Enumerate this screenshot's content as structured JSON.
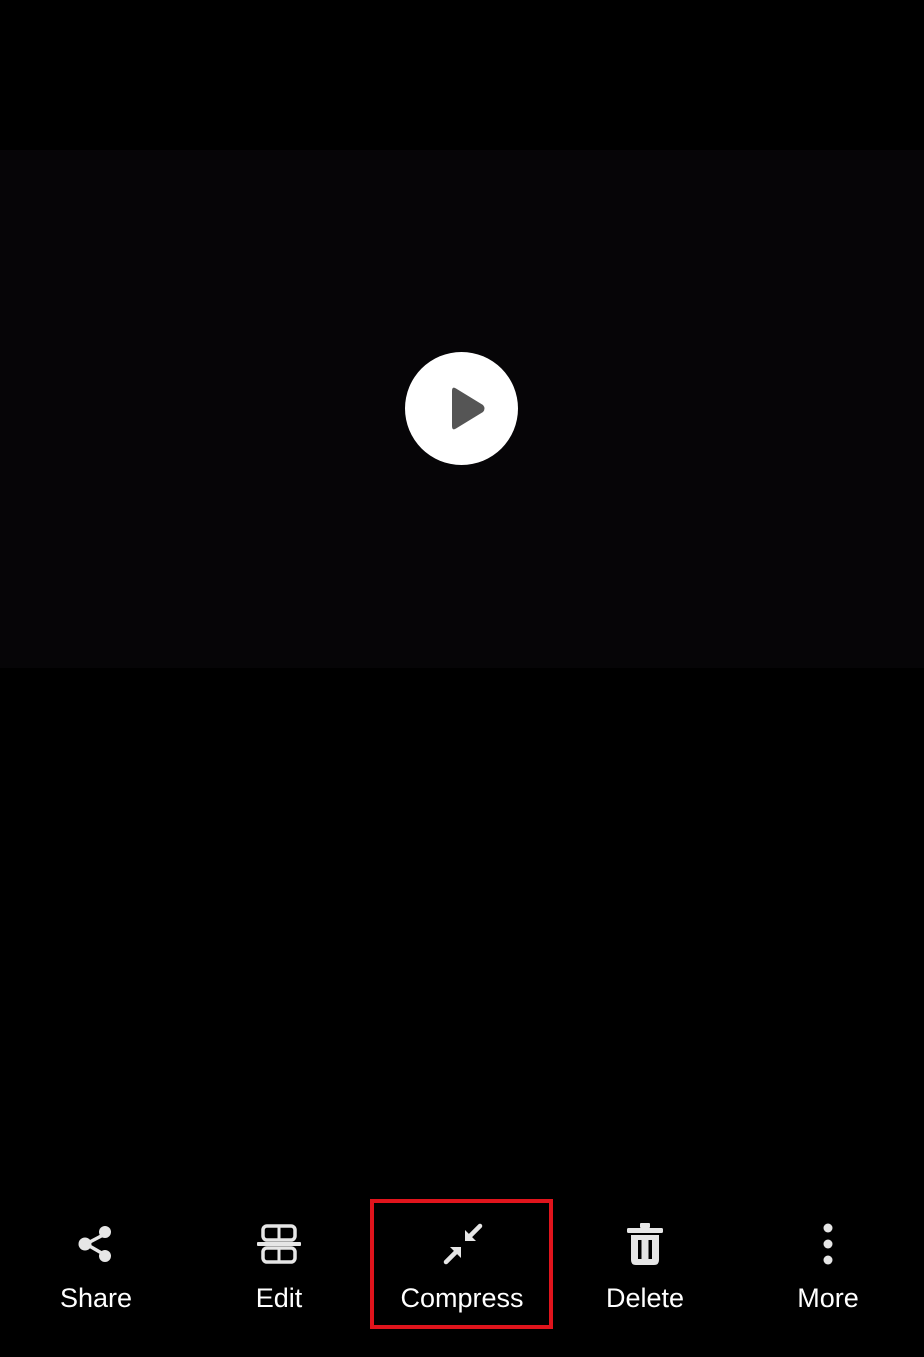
{
  "video": {
    "play_icon": "play-icon"
  },
  "toolbar": {
    "items": [
      {
        "label": "Share",
        "icon": "share-icon"
      },
      {
        "label": "Edit",
        "icon": "edit-icon"
      },
      {
        "label": "Compress",
        "icon": "compress-icon"
      },
      {
        "label": "Delete",
        "icon": "delete-icon"
      },
      {
        "label": "More",
        "icon": "more-vertical-icon"
      }
    ]
  },
  "colors": {
    "background": "#000000",
    "video_background": "#060507",
    "icon": "#e6e6e6",
    "play_triangle": "#555555",
    "highlight": "#e0141c"
  }
}
